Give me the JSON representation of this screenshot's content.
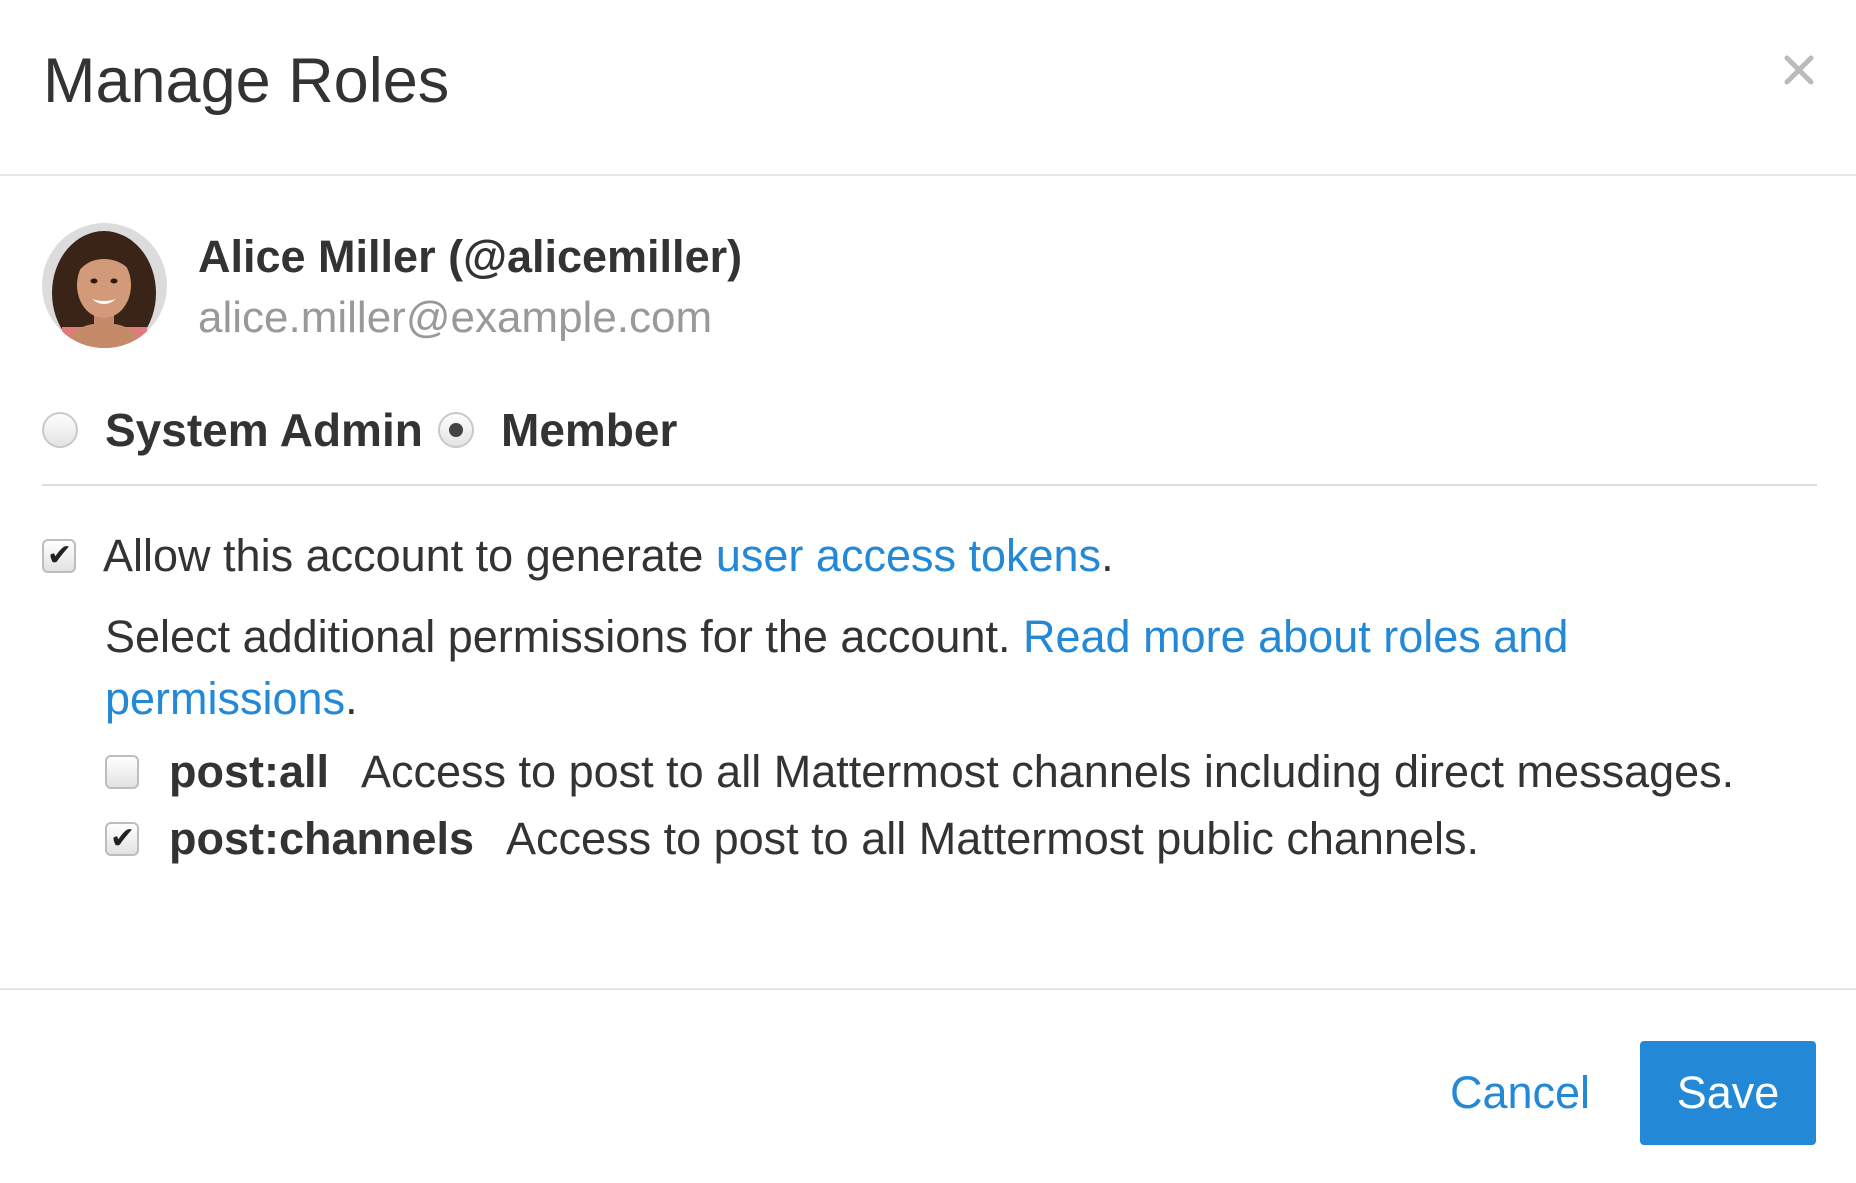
{
  "modal": {
    "title": "Manage Roles",
    "close_icon": "close-icon"
  },
  "user": {
    "name": "Alice Miller (@alicemiller)",
    "email": "alice.miller@example.com",
    "avatar": "user-avatar"
  },
  "roles": {
    "options": [
      {
        "label": "System Admin",
        "selected": false
      },
      {
        "label": "Member",
        "selected": true
      }
    ]
  },
  "tokens": {
    "checked": true,
    "text_before": "Allow this account to generate ",
    "link_text": "user access tokens",
    "text_after": "."
  },
  "permissions": {
    "description": "Select additional permissions for the account. ",
    "link_text": "Read more about roles and permissions",
    "text_after": ".",
    "items": [
      {
        "name": "post:all",
        "description": "Access to post to all Mattermost channels including direct messages.",
        "checked": false
      },
      {
        "name": "post:channels",
        "description": "Access to post to all Mattermost public channels.",
        "checked": true
      }
    ]
  },
  "footer": {
    "cancel_label": "Cancel",
    "save_label": "Save"
  },
  "colors": {
    "link": "#2389d7",
    "primary_button": "#2389d7",
    "email_gray": "#999999"
  }
}
